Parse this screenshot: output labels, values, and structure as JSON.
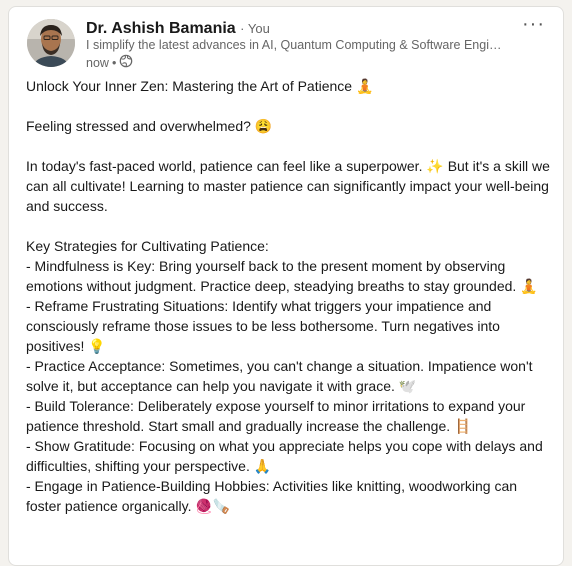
{
  "post": {
    "author": {
      "name": "Dr. Ashish Bamania",
      "badge": "You",
      "headline": "I simplify the latest advances in AI, Quantum Computing & Software Engi…",
      "time": "now",
      "visibility_icon": "globe-icon"
    },
    "menu_icon": "ellipsis-icon",
    "body": {
      "title": "Unlock Your Inner Zen: Mastering the Art of Patience",
      "title_emoji": "🧘",
      "feeling": "Feeling stressed and overwhelmed?",
      "feeling_emoji": "😩",
      "intro_a": "In today's fast-paced world, patience can feel like a superpower.",
      "intro_emoji": "✨",
      "intro_b": "But it's a skill we can all cultivate! Learning to master patience can significantly impact your well-being and success.",
      "strategies_heading": "Key Strategies for Cultivating Patience:",
      "strategies": [
        {
          "text": "- Mindfulness is Key: Bring yourself back to the present moment by observing emotions without judgment. Practice deep, steadying breaths to stay grounded.",
          "emoji": "🧘"
        },
        {
          "text": "- Reframe Frustrating Situations: Identify what triggers your impatience and consciously reframe those issues to be less bothersome. Turn negatives into positives!",
          "emoji": "💡"
        },
        {
          "text": "- Practice Acceptance: Sometimes, you can't change a situation. Impatience won't solve it, but acceptance can help you navigate it with grace.",
          "emoji": "🕊️"
        },
        {
          "text": "- Build Tolerance: Deliberately expose yourself to minor irritations to expand your patience threshold. Start small and gradually increase the challenge.",
          "emoji": "🪜"
        },
        {
          "text": "- Show Gratitude: Focusing on what you appreciate helps you cope with delays and difficulties, shifting your perspective.",
          "emoji": "🙏"
        },
        {
          "text": "- Engage in Patience-Building Hobbies: Activities like knitting, woodworking can foster patience organically.",
          "emoji": "🧶🪚"
        }
      ]
    }
  }
}
